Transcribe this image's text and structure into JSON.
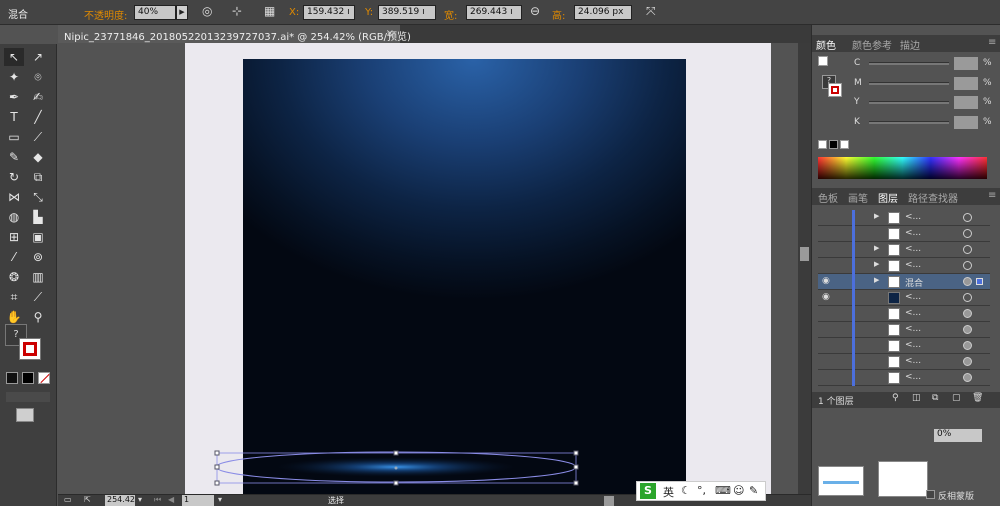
{
  "control_bar": {
    "selection_label": "混合",
    "opacity_label": "不透明度:",
    "opacity_value": "40%",
    "x_label": "X:",
    "x_value": "159.432 ı",
    "y_label": "Y:",
    "y_value": "389.519 ı",
    "w_label": "宽:",
    "w_value": "269.443 ı",
    "h_label": "高:",
    "h_value": "24.096 px"
  },
  "document": {
    "tab_title": "Nipic_23771846_20180522013239727037.ai* @ 254.42% (RGB/预览)",
    "close_glyph": "×"
  },
  "status": {
    "zoom": "254.42",
    "page": "1",
    "mode": "选择"
  },
  "color_panel": {
    "tabs": [
      "颜色",
      "颜色参考",
      "描边"
    ],
    "channels": [
      {
        "label": "C",
        "unit": "%"
      },
      {
        "label": "M",
        "unit": "%"
      },
      {
        "label": "Y",
        "unit": "%"
      },
      {
        "label": "K",
        "unit": "%"
      }
    ]
  },
  "layers_panel": {
    "tabs": [
      "色板",
      "画笔",
      "图层",
      "路径查找器"
    ],
    "rows": [
      {
        "name": "<...",
        "has_arrow": true,
        "eye": false
      },
      {
        "name": "<...",
        "has_arrow": false,
        "eye": false
      },
      {
        "name": "<...",
        "has_arrow": true,
        "eye": false
      },
      {
        "name": "<...",
        "has_arrow": true,
        "eye": false
      },
      {
        "name": "混合",
        "has_arrow": true,
        "eye": true,
        "selected": true
      },
      {
        "name": "<...",
        "has_arrow": false,
        "eye": true
      },
      {
        "name": "<...",
        "has_arrow": false,
        "eye": false
      },
      {
        "name": "<...",
        "has_arrow": false,
        "eye": false
      },
      {
        "name": "<...",
        "has_arrow": false,
        "eye": false
      },
      {
        "name": "<...",
        "has_arrow": false,
        "eye": false
      },
      {
        "name": "<...",
        "has_arrow": false,
        "eye": false
      }
    ],
    "footer": "1 个图层"
  },
  "transparency_panel": {
    "opacity": "0%",
    "checkbox_label": "反相蒙版"
  },
  "ime_bar": {
    "logo": "S",
    "lang": "英"
  },
  "colors": {
    "accent_orange": "#e08a00",
    "layer_bar": "#4c6fdc",
    "selected_row": "#4a6384"
  }
}
